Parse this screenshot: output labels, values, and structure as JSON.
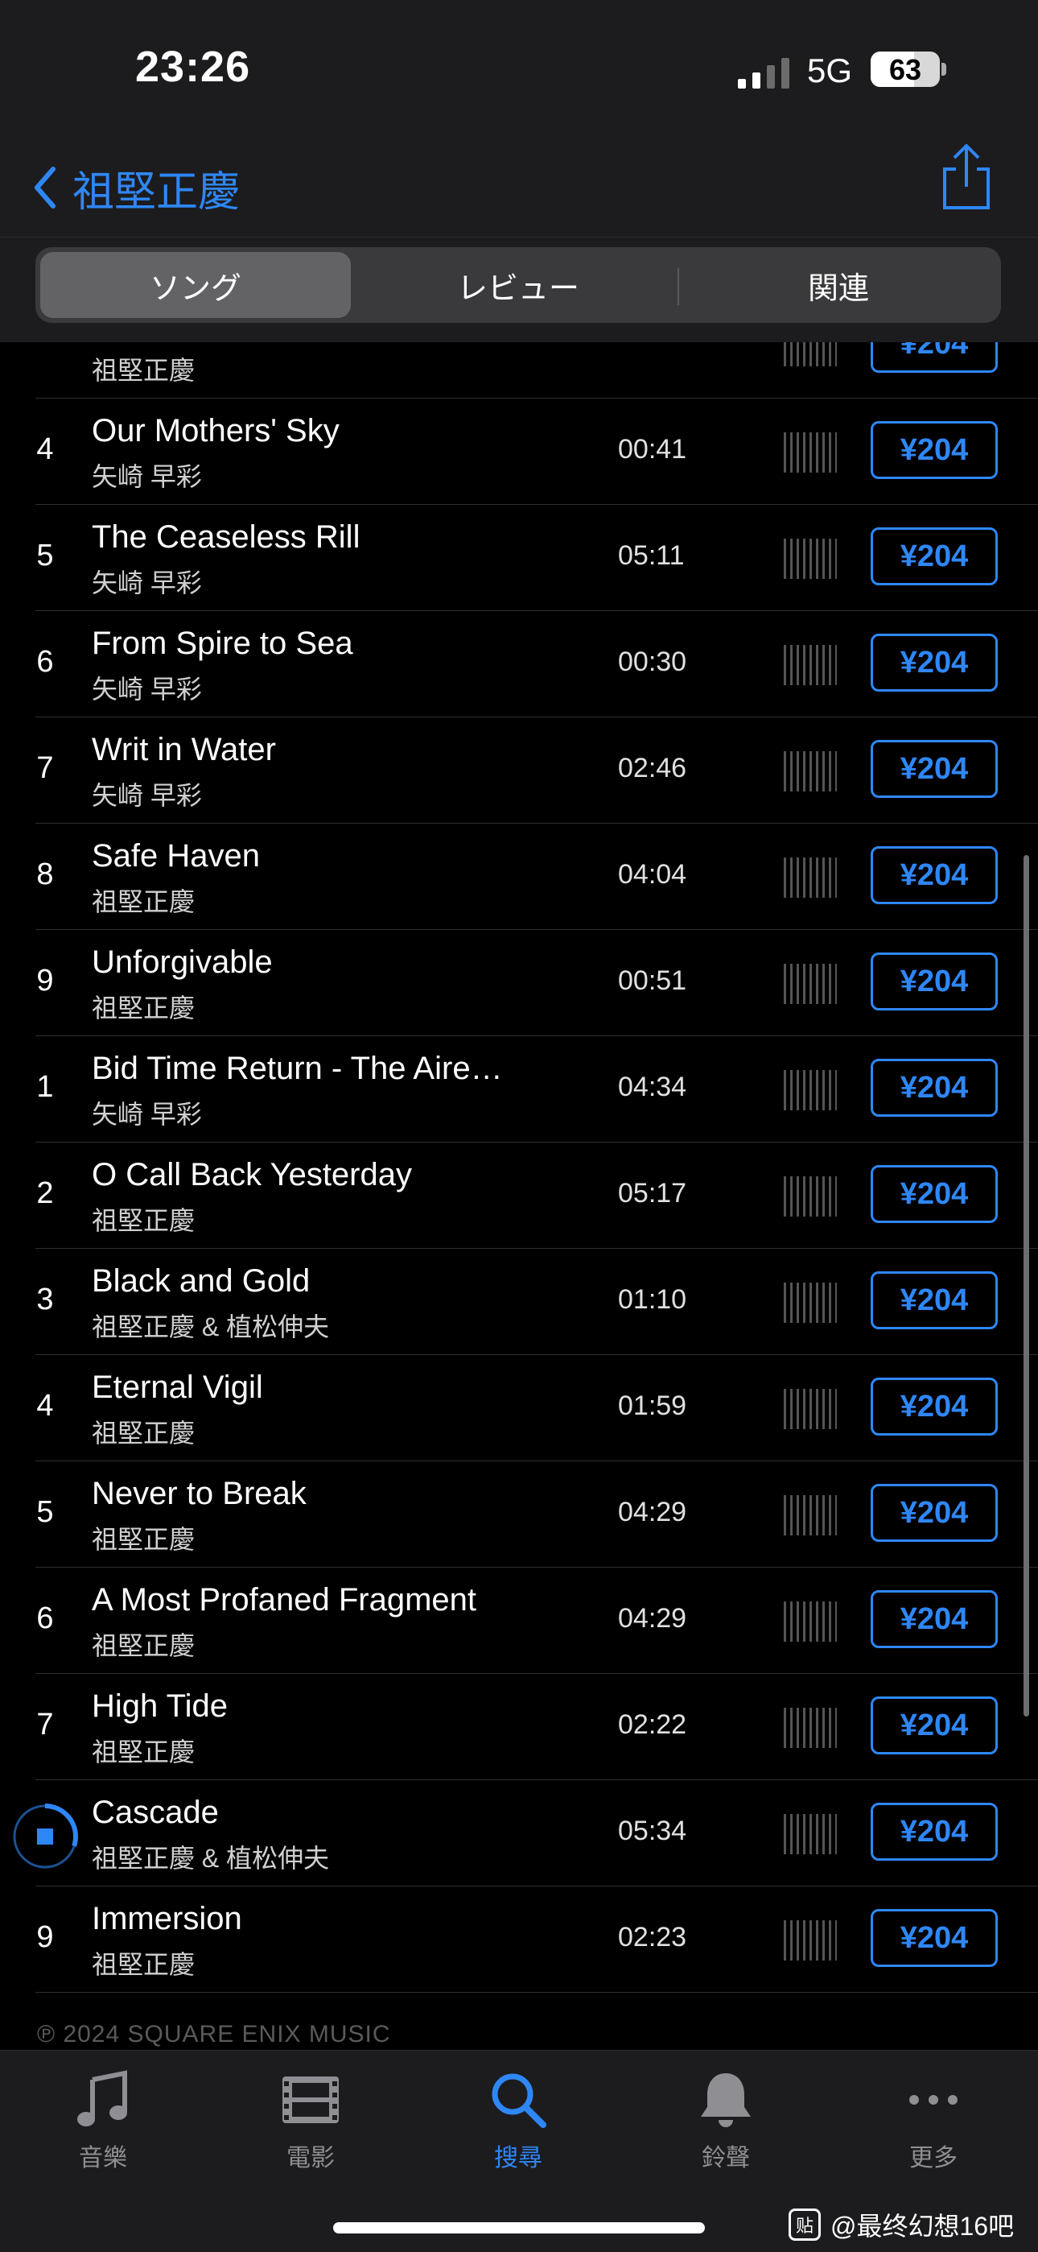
{
  "status": {
    "time": "23:26",
    "network": "5G",
    "battery": "63",
    "battery_level": 0.63
  },
  "nav": {
    "back_label": "祖堅正慶"
  },
  "segments": [
    "ソング",
    "レビュー",
    "関連"
  ],
  "colors": {
    "accent": "#2f87f7",
    "background": "#000000",
    "bar": "#1c1c1e"
  },
  "partial_row": {
    "artist": "祖堅正慶",
    "price": "¥204"
  },
  "tracks": [
    {
      "num": "4",
      "title": "Our Mothers' Sky",
      "artist": "矢崎 早彩",
      "duration": "00:41",
      "price": "¥204"
    },
    {
      "num": "5",
      "title": "The Ceaseless Rill",
      "artist": "矢崎 早彩",
      "duration": "05:11",
      "price": "¥204"
    },
    {
      "num": "6",
      "title": "From Spire to Sea",
      "artist": "矢崎 早彩",
      "duration": "00:30",
      "price": "¥204"
    },
    {
      "num": "7",
      "title": "Writ in Water",
      "artist": "矢崎 早彩",
      "duration": "02:46",
      "price": "¥204"
    },
    {
      "num": "8",
      "title": "Safe Haven",
      "artist": "祖堅正慶",
      "duration": "04:04",
      "price": "¥204"
    },
    {
      "num": "9",
      "title": "Unforgivable",
      "artist": "祖堅正慶",
      "duration": "00:51",
      "price": "¥204"
    },
    {
      "num": "1",
      "title": "Bid Time Return - The Aire…",
      "artist": "矢崎 早彩",
      "duration": "04:34",
      "price": "¥204"
    },
    {
      "num": "2",
      "title": "O Call Back Yesterday",
      "artist": "祖堅正慶",
      "duration": "05:17",
      "price": "¥204"
    },
    {
      "num": "3",
      "title": "Black and Gold",
      "artist": "祖堅正慶 & 植松伸夫",
      "duration": "01:10",
      "price": "¥204"
    },
    {
      "num": "4",
      "title": "Eternal Vigil",
      "artist": "祖堅正慶",
      "duration": "01:59",
      "price": "¥204"
    },
    {
      "num": "5",
      "title": "Never to Break",
      "artist": "祖堅正慶",
      "duration": "04:29",
      "price": "¥204"
    },
    {
      "num": "6",
      "title": "A Most Profaned Fragment",
      "artist": "祖堅正慶",
      "duration": "04:29",
      "price": "¥204"
    },
    {
      "num": "7",
      "title": "High Tide",
      "artist": "祖堅正慶",
      "duration": "02:22",
      "price": "¥204"
    },
    {
      "num": "",
      "title": "Cascade",
      "artist": "祖堅正慶 & 植松伸夫",
      "duration": "05:34",
      "price": "¥204",
      "playing": true,
      "play_progress": 0.3
    },
    {
      "num": "9",
      "title": "Immersion",
      "artist": "祖堅正慶",
      "duration": "02:23",
      "price": "¥204"
    }
  ],
  "copyright": "℗ 2024 SQUARE ENIX MUSIC",
  "tabs": [
    {
      "label": "音樂",
      "icon": "music-note-icon"
    },
    {
      "label": "電影",
      "icon": "film-icon"
    },
    {
      "label": "搜尋",
      "icon": "search-icon",
      "active": true
    },
    {
      "label": "鈴聲",
      "icon": "bell-icon"
    },
    {
      "label": "更多",
      "icon": "more-icon"
    }
  ],
  "watermark": {
    "icon_text": "贴",
    "text": "@最终幻想16吧"
  }
}
